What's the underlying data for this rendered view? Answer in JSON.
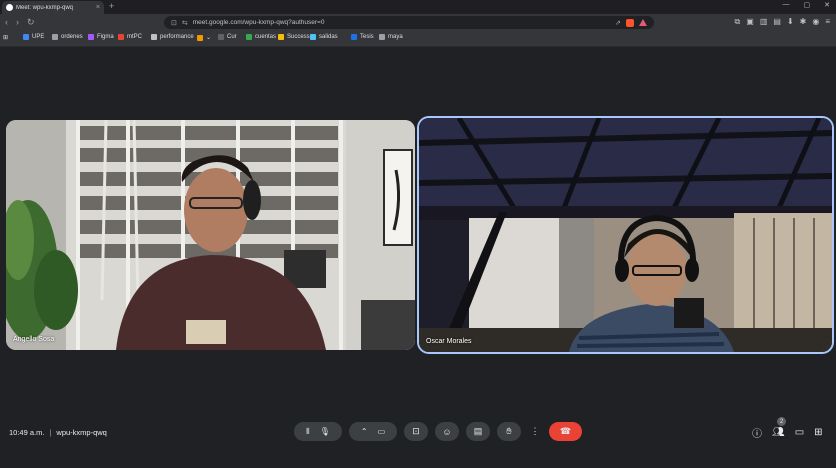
{
  "browser": {
    "tab_title": "Meet: wpu-kxmp-qwq",
    "tab_close": "×",
    "new_tab": "+",
    "window_controls": [
      "—",
      "▢",
      "✕"
    ],
    "url": "meet.google.com/wpu-kxmp-qwq?authuser=0",
    "bookmarks": [
      "UPE",
      "ordenes",
      "Figma",
      "mtPC",
      "performance",
      "Cur",
      "cuentas",
      "Success",
      "salidas",
      "Tesis",
      "maya"
    ]
  },
  "participants": [
    {
      "name": "Angello Sosa"
    },
    {
      "name": "Oscar Morales"
    }
  ],
  "meeting": {
    "time": "10:49 a.m.",
    "separator": "|",
    "code": "wpu-kxmp-qwq"
  },
  "people_count": "2",
  "colors": {
    "background": "#202124",
    "control_button": "#3c4043",
    "end_call": "#ea4335",
    "active_speaker_border": "#a8c7fa"
  },
  "icons": {
    "audio_visualizer": "audio-visualizer-icon",
    "mic": "mic-icon",
    "camera": "camera-icon",
    "present": "present-icon",
    "emoji": "emoji-icon",
    "captions": "captions-icon",
    "raise_hand": "raise-hand-icon",
    "more": "more-options-icon",
    "end_call": "end-call-icon",
    "info": "info-icon",
    "people": "people-icon",
    "chat": "chat-icon",
    "activities": "activities-icon"
  }
}
